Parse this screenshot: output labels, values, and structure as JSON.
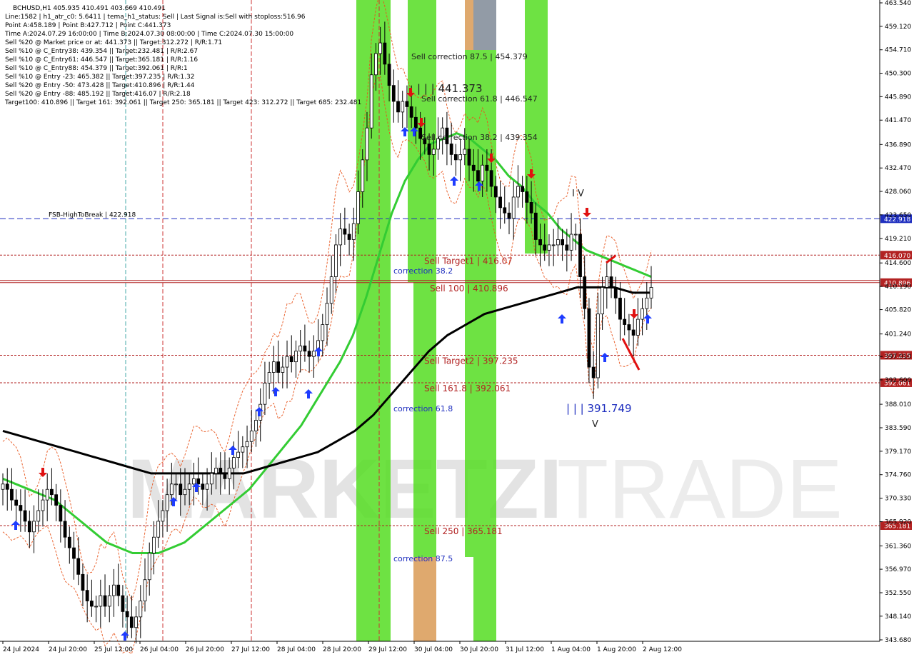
{
  "header": {
    "symbol_line": "BCHUSD,H1  405.935 410.491 403.669 410.491",
    "lines": [
      "Line:1582  | h1_atr_c0: 5.6411  | tema_h1_status: Sell  | Last Signal is:Sell with stoploss:516.96",
      "Point A:458.189  | Point B:427.712  | Point C:441.373",
      "Time A:2024.07.29 16:00:00  | Time B:2024.07.30 08:00:00  | Time C:2024.07.30 15:00:00",
      "Sell %20 @ Market price or at: 441.373  || Target:312.272  | R/R:1.71",
      "Sell %10 @ C_Entry38: 439.354  || Target:232.481  | R/R:2.67",
      "Sell %10 @ C_Entry61: 446.547  || Target:365.181  | R/R:1.16",
      "Sell %10 @ C_Entry88: 454.379  || Target:392.061  | R/R:1",
      "Sell %10 @ Entry -23: 465.382  || Target:397.235  | R/R:1.32",
      "Sell %20 @ Entry -50: 473.428  || Target:410.896  | R/R:1.44",
      "Sell %20 @ Entry -88: 485.192  || Target:416.07  | R/R:2.18",
      "Target100: 410.896  || Target 161: 392.061  || Target 250: 365.181  || Target 423: 312.272  || Target 685: 232.481"
    ]
  },
  "watermark": {
    "bold": "MARKETZI",
    "light": "TRADE"
  },
  "colors": {
    "bull": "#000000",
    "bear": "#000000",
    "ma_green": "#33cc33",
    "ma_black": "#000000",
    "level_red": "#b22222",
    "level_blue": "#1f2fbf",
    "zone_green": "#55dd22",
    "zone_orange": "#d99a55",
    "zone_gray": "#7f8a96"
  },
  "chart_data": {
    "type": "candlestick",
    "symbol": "BCHUSD",
    "timeframe": "H1",
    "ylim": [
      343.68,
      463.54
    ],
    "y_ticks": [
      463.54,
      459.12,
      454.71,
      450.3,
      445.89,
      441.47,
      436.89,
      432.47,
      428.06,
      423.65,
      419.21,
      414.6,
      410.19,
      405.82,
      401.24,
      397.01,
      392.6,
      388.01,
      383.59,
      379.17,
      374.76,
      370.33,
      365.92,
      361.36,
      356.97,
      352.55,
      348.14,
      343.68
    ],
    "x_labels": [
      "24 Jul 2024",
      "24 Jul 20:00",
      "25 Jul 12:00",
      "26 Jul 04:00",
      "26 Jul 20:00",
      "27 Jul 12:00",
      "28 Jul 04:00",
      "28 Jul 20:00",
      "29 Jul 12:00",
      "30 Jul 04:00",
      "30 Jul 20:00",
      "31 Jul 12:00",
      "1 Aug 04:00",
      "1 Aug 20:00",
      "2 Aug 12:00"
    ],
    "closes": [
      373,
      372,
      370,
      369,
      368,
      366,
      364,
      366,
      368,
      370,
      372,
      371,
      369,
      366,
      363,
      361,
      359,
      356,
      353,
      351,
      350,
      350,
      352,
      350,
      352,
      354,
      352,
      349,
      348,
      346,
      348,
      351,
      355,
      360,
      363,
      366,
      368,
      371,
      373,
      373,
      371,
      372,
      373,
      374,
      373,
      372,
      373,
      375,
      376,
      375,
      374,
      376,
      378,
      379,
      380,
      381,
      383,
      385,
      388,
      392,
      394,
      396,
      394,
      395,
      397,
      396,
      398,
      399,
      398,
      397,
      398,
      400,
      403,
      407,
      412,
      418,
      421,
      420,
      419,
      422,
      428,
      434,
      440,
      450,
      454,
      456,
      452,
      448,
      445,
      443,
      445,
      444,
      442,
      440,
      438,
      437,
      435,
      436,
      438,
      440,
      437,
      435,
      434,
      435,
      436,
      433,
      432,
      430,
      433,
      432,
      429,
      427,
      425,
      424,
      423,
      427,
      429,
      428,
      426,
      424,
      419,
      418,
      417,
      418,
      418,
      419,
      418,
      417,
      420,
      420,
      412,
      406,
      395,
      393,
      405,
      410,
      412,
      410,
      408,
      404,
      403,
      402,
      401,
      404,
      406,
      408,
      410
    ],
    "ma_green": [
      374,
      373,
      372,
      371,
      370,
      368,
      366,
      364,
      362,
      361,
      360,
      360,
      360,
      361,
      362,
      364,
      366,
      368,
      370,
      372,
      375,
      378,
      381,
      384,
      388,
      392,
      396,
      401,
      408,
      416,
      424,
      430,
      434,
      437,
      438,
      439,
      438,
      436,
      434,
      431,
      429,
      426,
      424,
      421,
      419,
      417,
      416,
      415,
      414,
      413,
      412
    ],
    "ma_black": [
      383,
      382,
      381,
      380,
      379,
      378,
      377,
      376,
      375,
      375,
      375,
      375,
      375,
      375,
      376,
      377,
      378,
      379,
      381,
      383,
      386,
      390,
      394,
      398,
      401,
      403,
      405,
      406,
      407,
      408,
      409,
      410,
      410,
      410,
      409,
      409
    ],
    "levels": [
      {
        "label": "FSB-HighToBreak | 422.918",
        "value": 422.918,
        "tag": "422.918",
        "style": "blue-dash"
      },
      {
        "label": "Sell Target1 | 416.07",
        "value": 416.07,
        "tag": "416.070",
        "style": "red-dot"
      },
      {
        "label": "Sell 100 | 410.896",
        "value": 410.896,
        "tag": "410.896",
        "style": "red-solid"
      },
      {
        "label": "Sell Target2 | 397.235",
        "value": 397.235,
        "tag": "397.235",
        "style": "red-dot"
      },
      {
        "label": "Sell 161.8 | 392.061",
        "value": 392.061,
        "tag": "392.061",
        "style": "red-dot"
      },
      {
        "label": "Sell 250 | 365.181",
        "value": 365.181,
        "tag": "365.181",
        "style": "red-dot"
      }
    ],
    "annotations": [
      {
        "text": "correction 38.2",
        "color": "blue"
      },
      {
        "text": "correction 61.8",
        "color": "blue"
      },
      {
        "text": "correction 87.5",
        "color": "blue"
      },
      {
        "text": "Sell correction 87.5 | 454.379",
        "color": "dark"
      },
      {
        "text": "Sell correction 61.8 | 446.547",
        "color": "dark"
      },
      {
        "text": "Sell correction 38.2 | 439.354",
        "color": "dark"
      },
      {
        "text": "| | | 441.373",
        "color": "dark"
      },
      {
        "text": "| | | 391.749",
        "color": "blue"
      },
      {
        "text": "I V",
        "color": "dark"
      },
      {
        "text": "V",
        "color": "dark"
      }
    ]
  }
}
